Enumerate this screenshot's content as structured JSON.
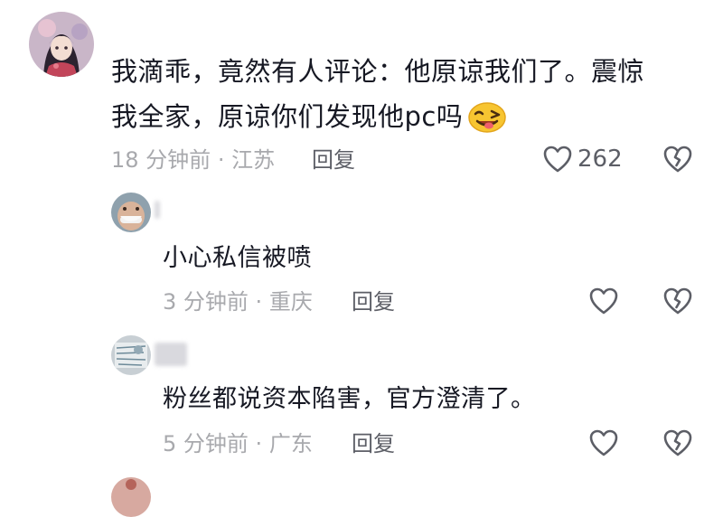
{
  "comments": [
    {
      "text_line1": "我滴乖，竟然有人评论：他原谅我们了。震惊",
      "text_line2": "我全家，原谅你们发现他pc吗",
      "time": "18 分钟前",
      "location": "江苏",
      "reply_label": "回复",
      "like_count": "262"
    },
    {
      "text": "小心私信被喷",
      "time": "3 分钟前",
      "location": "重庆",
      "reply_label": "回复"
    },
    {
      "text": "粉丝都说资本陷害，官方澄清了。",
      "time": "5 分钟前",
      "location": "广东",
      "reply_label": "回复"
    }
  ],
  "meta_separator": "·",
  "icons": {
    "like": "heart-outline-icon",
    "dislike": "broken-heart-icon",
    "emoji": "winking-tongue-emoji"
  },
  "colors": {
    "text": "#161823",
    "meta": "#a8a9ad",
    "icon": "#5c5e66"
  }
}
